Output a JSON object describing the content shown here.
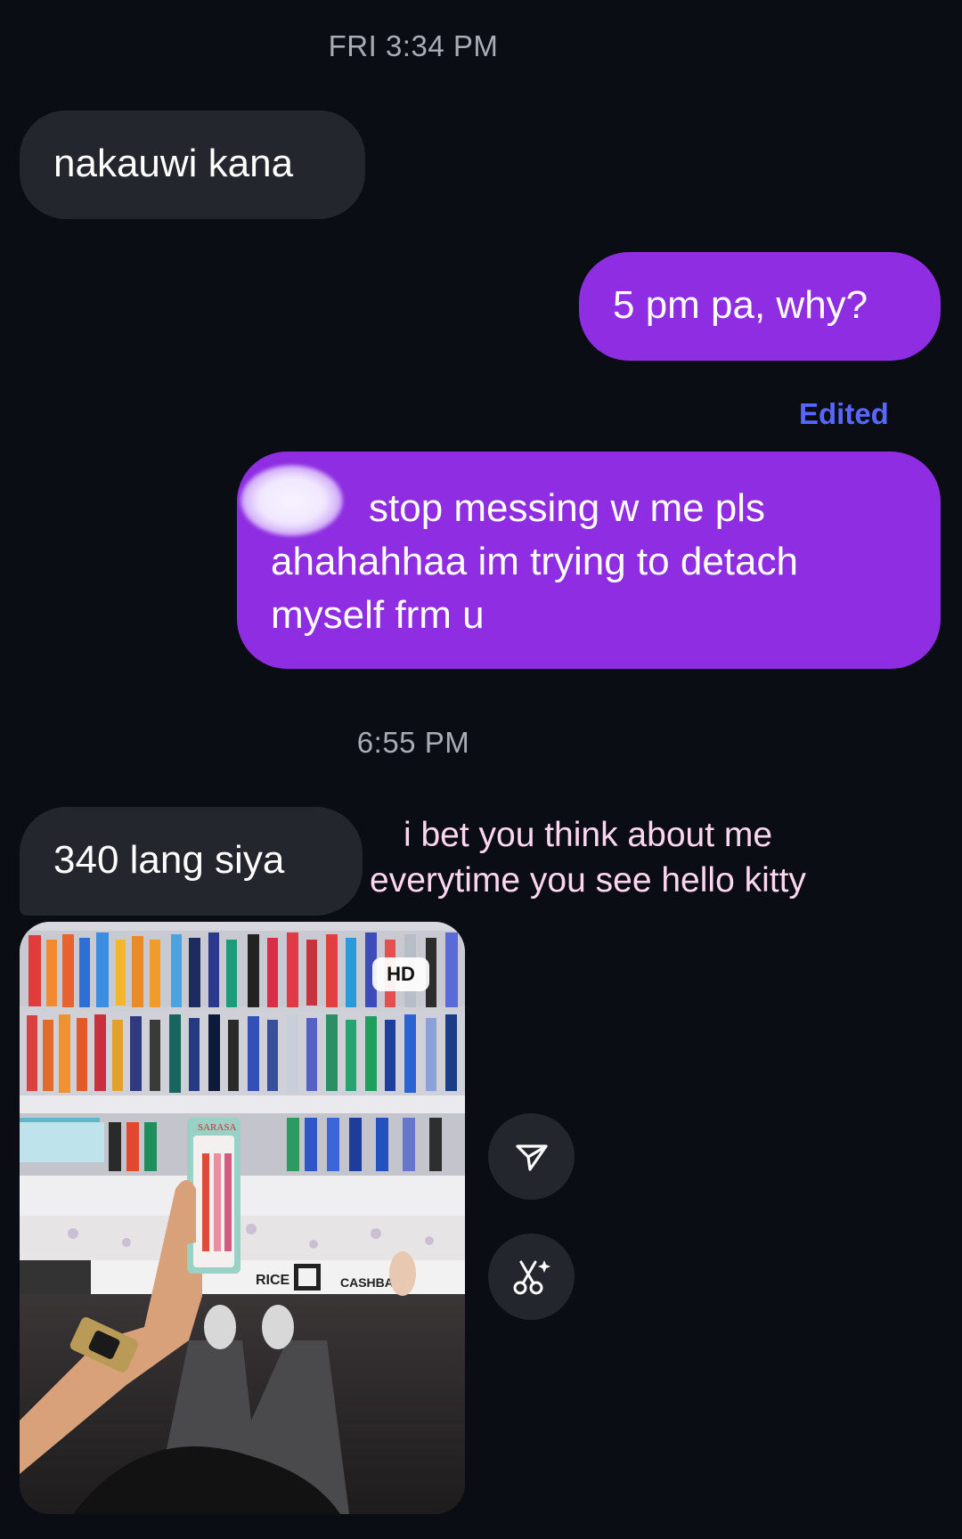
{
  "timestamps": {
    "first": "FRI 3:34 PM",
    "second": "6:55 PM"
  },
  "messages": [
    {
      "direction": "incoming",
      "text": "nakauwi kana"
    },
    {
      "direction": "outgoing",
      "text": "5 pm pa, why?"
    },
    {
      "direction": "outgoing",
      "status": "Edited",
      "text_line1": "stop messing w me pls",
      "text_line2": "ahahahhaa im trying to detach",
      "text_line3": "myself frm u"
    },
    {
      "direction": "incoming",
      "text": "340 lang siya"
    }
  ],
  "overlay_caption": {
    "line1": "i bet you think about me",
    "line2": "everytime you see hello kitty"
  },
  "photo": {
    "badge": "HD",
    "store_text_1": "RICE",
    "store_text_2": "CASHBACK",
    "product_label": "SARASA"
  },
  "actions": {
    "share_icon": "paper-plane-icon",
    "remix_icon": "scissors-sparkle-icon"
  },
  "colors": {
    "background": "#0b0d14",
    "incoming_bubble": "#24262d",
    "outgoing_bubble": "#8e2de2",
    "edited_label": "#5867ff",
    "caption": "#ffd6ef"
  }
}
